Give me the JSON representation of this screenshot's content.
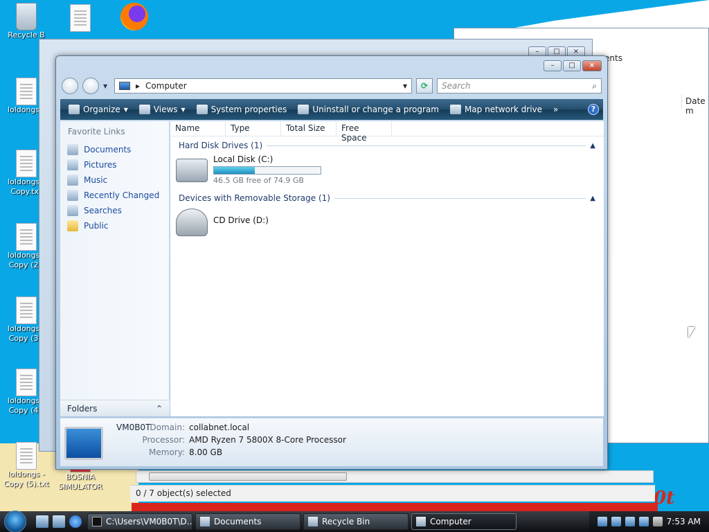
{
  "desktop": {
    "icons": [
      {
        "label": "Recycle B",
        "type": "bin"
      },
      {
        "label": "loldongs.t",
        "type": "doc"
      },
      {
        "label": "loldongs - Copy.txt",
        "type": "doc"
      },
      {
        "label": "loldongs - Copy (2).",
        "type": "doc"
      },
      {
        "label": "loldongs - Copy (3).",
        "type": "doc"
      },
      {
        "label": "loldongs - Copy (4).",
        "type": "doc"
      },
      {
        "label": "loldongs - Copy (5).txt",
        "type": "doc"
      },
      {
        "label": "BOSNIA SIMULATOR",
        "type": "doc"
      }
    ],
    "wallpaper_text": "0t"
  },
  "behind_window": {
    "title_fragment": "ents",
    "column_date": "Date m",
    "status": "0 / 7 object(s) selected"
  },
  "window": {
    "address": {
      "location": "Computer"
    },
    "search": {
      "placeholder": "Search"
    },
    "toolbar": {
      "organize": "Organize",
      "views": "Views",
      "system_properties": "System properties",
      "uninstall": "Uninstall or change a program",
      "map_drive": "Map network drive",
      "more": "»",
      "help": "?"
    },
    "nav": {
      "heading": "Favorite Links",
      "links": [
        "Documents",
        "Pictures",
        "Music",
        "Recently Changed",
        "Searches",
        "Public"
      ],
      "folders": "Folders"
    },
    "columns": [
      "Name",
      "Type",
      "Total Size",
      "Free Space"
    ],
    "groups": {
      "hdd": "Hard Disk Drives (1)",
      "removable": "Devices with Removable Storage (1)"
    },
    "drives": {
      "c": {
        "name": "Local Disk (C:)",
        "free_text": "46.5 GB free of 74.9 GB",
        "used_fraction": 0.38
      },
      "d": {
        "name": "CD Drive (D:)"
      }
    },
    "details": {
      "computer_name": "VM0B0T",
      "domain_label": "Domain:",
      "domain": "collabnet.local",
      "processor_label": "Processor:",
      "processor": "AMD Ryzen 7 5800X 8-Core Processor",
      "memory_label": "Memory:",
      "memory": "8.00 GB"
    }
  },
  "taskbar": {
    "tasks": [
      {
        "label": "C:\\Users\\VM0B0T\\D...",
        "active": false
      },
      {
        "label": "Documents",
        "active": false
      },
      {
        "label": "Recycle Bin",
        "active": false
      },
      {
        "label": "Computer",
        "active": true
      }
    ],
    "clock": "7:53 AM"
  }
}
